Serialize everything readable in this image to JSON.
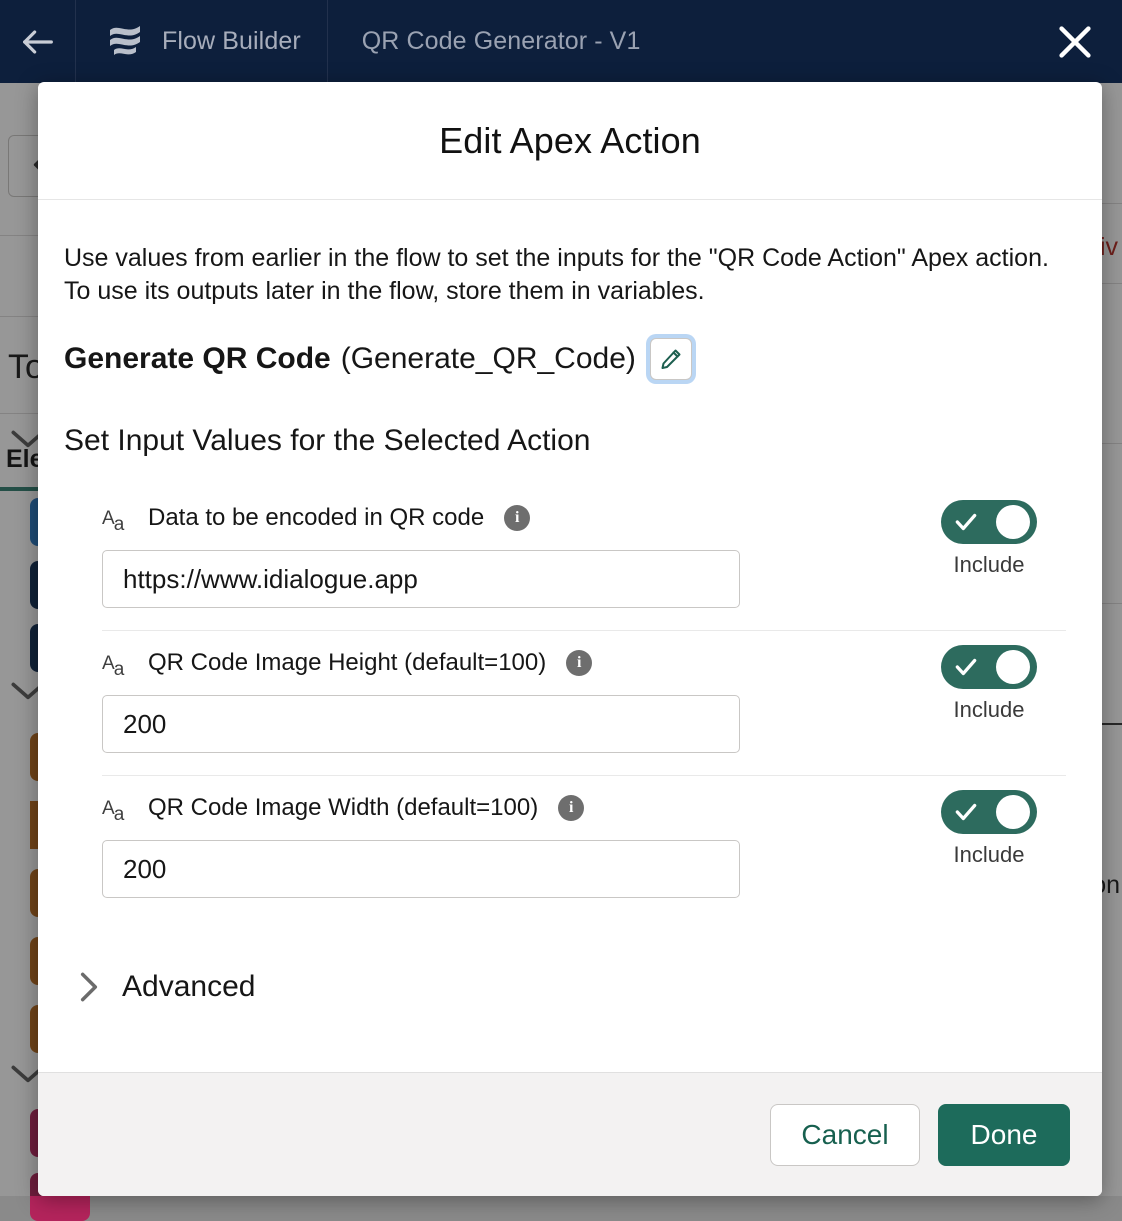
{
  "topbar": {
    "back_icon": "arrow-left-icon",
    "app_icon": "flow-builder-logo-icon",
    "app_label": "Flow Builder",
    "flow_name": "QR Code Generator - V1",
    "close_icon": "close-icon"
  },
  "background": {
    "undo_icon": "undo-icon",
    "toolbox_label": "To",
    "elements_label": "Ele",
    "right_text_red": "iv",
    "right_text_dark": "on"
  },
  "modal": {
    "title": "Edit Apex Action",
    "intro": "Use values from earlier in the flow to set the inputs for the \"QR Code Action\" Apex action. To use its outputs later in the flow, store them in variables.",
    "action_label": "Generate QR Code",
    "action_api_name": "(Generate_QR_Code)",
    "edit_icon": "pencil-icon",
    "section_title": "Set Input Values for the Selected Action",
    "advanced_label": "Advanced",
    "advanced_chevron_icon": "chevron-right-icon",
    "inputs": [
      {
        "type_icon": "text-type-icon",
        "label": "Data to be encoded in QR code",
        "info_icon": "info-icon",
        "value": "https://www.idialogue.app",
        "placeholder": "",
        "toggle_label": "Include",
        "toggle_on": true,
        "toggle_icon": "check-icon"
      },
      {
        "type_icon": "text-type-icon",
        "label": "QR Code Image Height (default=100)",
        "info_icon": "info-icon",
        "value": "200",
        "placeholder": "",
        "toggle_label": "Include",
        "toggle_on": true,
        "toggle_icon": "check-icon"
      },
      {
        "type_icon": "text-type-icon",
        "label": "QR Code Image Width (default=100)",
        "info_icon": "info-icon",
        "value": "200",
        "placeholder": "",
        "toggle_label": "Include",
        "toggle_on": true,
        "toggle_icon": "check-icon"
      }
    ],
    "footer": {
      "cancel_label": "Cancel",
      "done_label": "Done"
    }
  },
  "colors": {
    "topbar_bg": "#0d1f3c",
    "toggle_on": "#2d6b5e",
    "primary_button": "#1d6b5b",
    "accent_green": "#2e7d6e"
  }
}
